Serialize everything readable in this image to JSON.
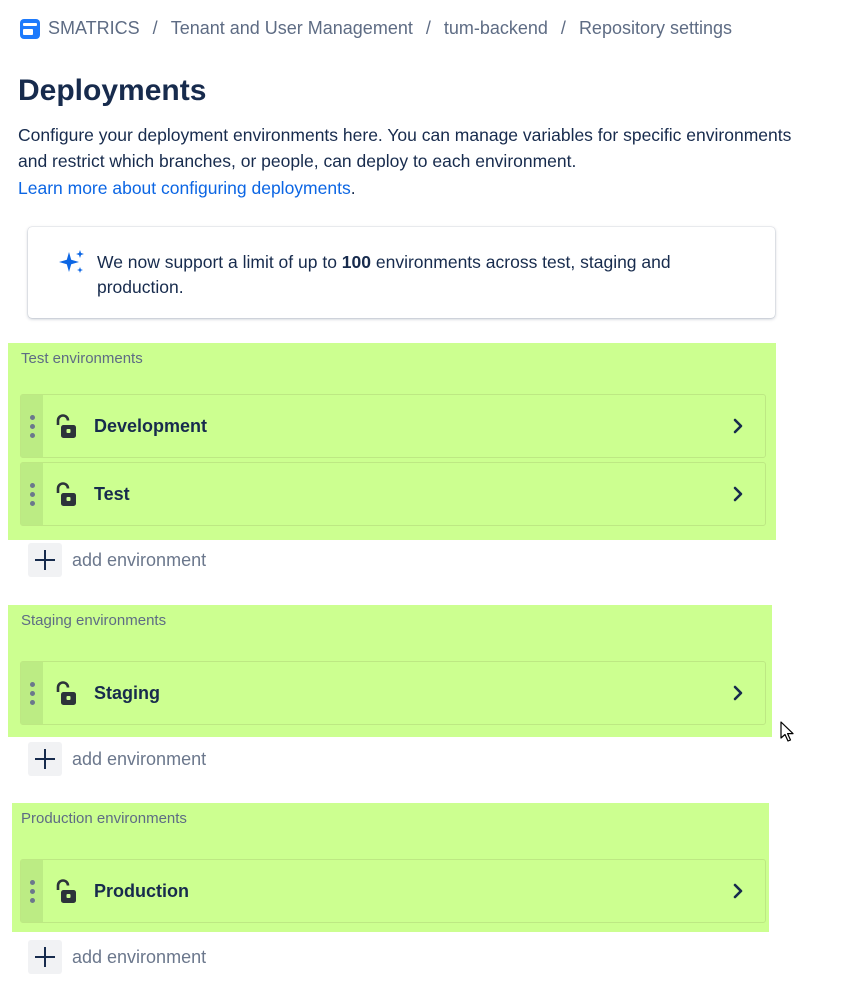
{
  "breadcrumb": {
    "items": [
      "SMATRICS",
      "Tenant and User Management",
      "tum-backend",
      "Repository settings"
    ],
    "separator": "/"
  },
  "page": {
    "title": "Deployments",
    "description": "Configure your deployment environments here. You can manage variables for specific environments and restrict which branches, or people, can deploy to each environment.",
    "learn_more_link": "Learn more about configuring deployments",
    "learn_more_suffix": "."
  },
  "notice": {
    "text_before": "We now support a limit of up to ",
    "text_bold": "100",
    "text_after": " environments across test, staging and production.",
    "icon": "sparkle-icon",
    "icon_color": "#0c66e4"
  },
  "groups": [
    {
      "label": "Test environments",
      "environments": [
        "Development",
        "Test"
      ],
      "add_label": "add environment"
    },
    {
      "label": "Staging environments",
      "environments": [
        "Staging"
      ],
      "add_label": "add environment"
    },
    {
      "label": "Production environments",
      "environments": [
        "Production"
      ],
      "add_label": "add environment"
    }
  ],
  "colors": {
    "highlight": "#ccff90",
    "link": "#0c66e4",
    "text": "#172b4d",
    "subtle": "#5e6c84"
  },
  "icons": {
    "environment": "unlocked-padlock-icon",
    "handle": "drag-handle-icon",
    "chevron": "chevron-right-icon",
    "add": "plus-icon"
  }
}
